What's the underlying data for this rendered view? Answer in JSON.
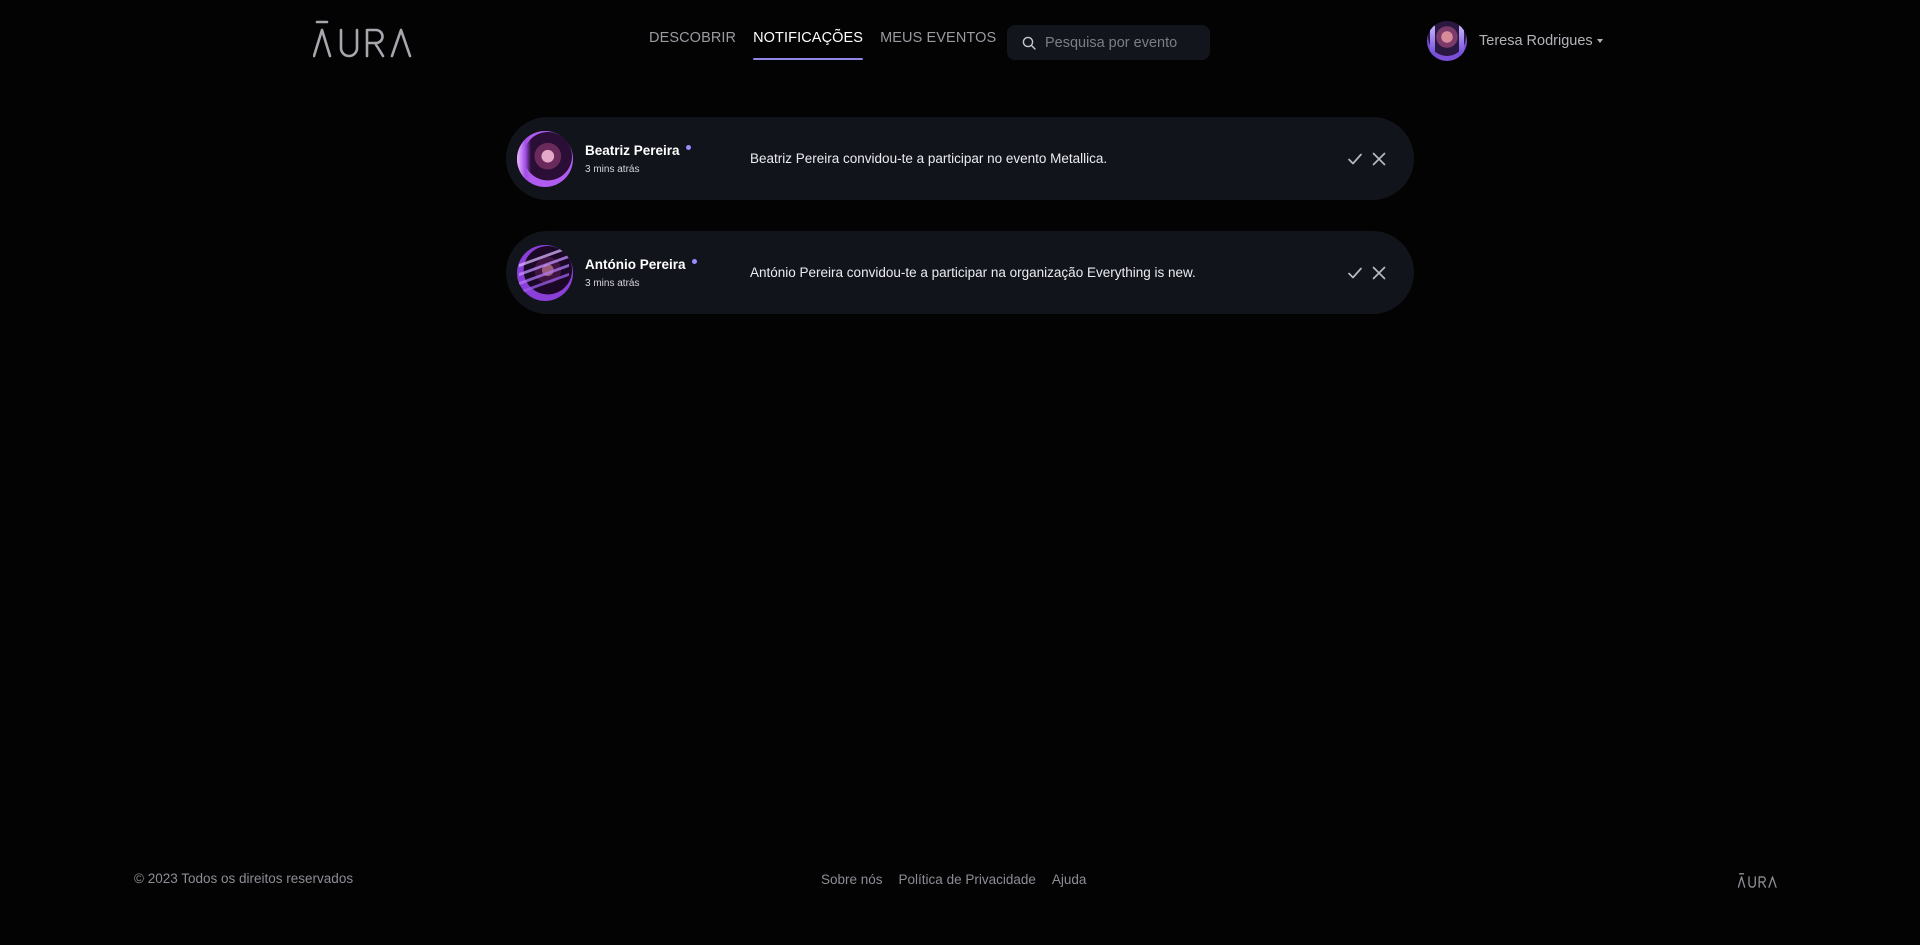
{
  "brand": {
    "logo_text": "ĀURA",
    "accent_color": "#8f86e6"
  },
  "nav": {
    "items": [
      {
        "label": "DESCOBRIR",
        "active": false
      },
      {
        "label": "NOTIFICAÇÕES",
        "active": true
      },
      {
        "label": "MEUS EVENTOS",
        "active": false
      }
    ]
  },
  "search": {
    "placeholder": "Pesquisa por evento",
    "icon": "search-icon"
  },
  "user": {
    "name": "Teresa Rodrigues",
    "icon": "chevron-down-icon"
  },
  "notifications": [
    {
      "sender": "Beatriz Pereira",
      "time": "3 mins atrás",
      "message": "Beatriz Pereira convidou-te a participar no evento Metallica.",
      "unread": true
    },
    {
      "sender": "António Pereira",
      "time": "3 mins atrás",
      "message": "António Pereira convidou-te a participar na organização Everything is new.",
      "unread": true
    }
  ],
  "footer": {
    "copyright": "© 2023 Todos os direitos reservados",
    "links": [
      "Sobre nós",
      "Política de Privacidade",
      "Ajuda"
    ]
  }
}
